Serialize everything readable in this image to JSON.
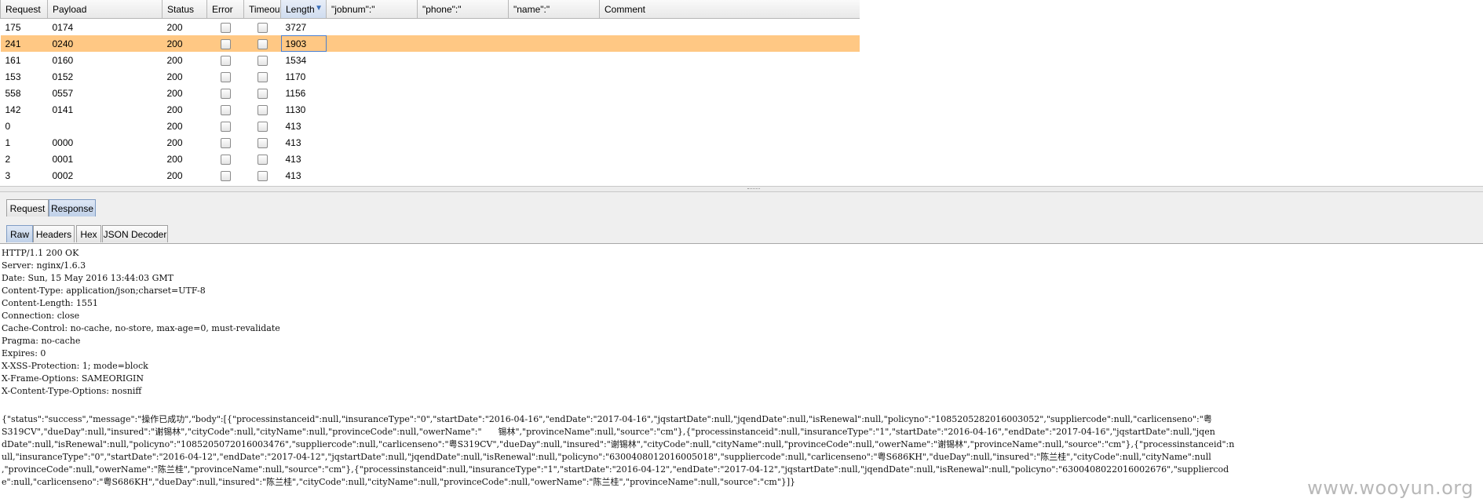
{
  "results": {
    "columns": [
      "Request",
      "Payload",
      "Status",
      "Error",
      "Timeout",
      "Length",
      "\"jobnum\":\"",
      "\"phone\":\"",
      "\"name\":\"",
      "Comment"
    ],
    "sorted_column": "Length",
    "sort_indicator": "▼",
    "rows": [
      {
        "request": "175",
        "payload": "0174",
        "status": "200",
        "length": "3727",
        "selected": false
      },
      {
        "request": "241",
        "payload": "0240",
        "status": "200",
        "length": "1903",
        "selected": true
      },
      {
        "request": "161",
        "payload": "0160",
        "status": "200",
        "length": "1534",
        "selected": false
      },
      {
        "request": "153",
        "payload": "0152",
        "status": "200",
        "length": "1170",
        "selected": false
      },
      {
        "request": "558",
        "payload": "0557",
        "status": "200",
        "length": "1156",
        "selected": false
      },
      {
        "request": "142",
        "payload": "0141",
        "status": "200",
        "length": "1130",
        "selected": false
      },
      {
        "request": "0",
        "payload": "",
        "status": "200",
        "length": "413",
        "selected": false
      },
      {
        "request": "1",
        "payload": "0000",
        "status": "200",
        "length": "413",
        "selected": false
      },
      {
        "request": "2",
        "payload": "0001",
        "status": "200",
        "length": "413",
        "selected": false
      },
      {
        "request": "3",
        "payload": "0002",
        "status": "200",
        "length": "413",
        "selected": false
      }
    ]
  },
  "tabs_top": [
    {
      "label": "Request",
      "active": false
    },
    {
      "label": "Response",
      "active": true
    }
  ],
  "tabs_sub": [
    {
      "label": "Raw",
      "active": true
    },
    {
      "label": "Headers",
      "active": false
    },
    {
      "label": "Hex",
      "active": false
    },
    {
      "label": "JSON Decoder",
      "active": false
    }
  ],
  "response": {
    "headers": [
      "HTTP/1.1 200 OK",
      "Server: nginx/1.6.3",
      "Date: Sun, 15 May 2016 13:44:03 GMT",
      "Content-Type: application/json;charset=UTF-8",
      "Content-Length: 1551",
      "Connection: close",
      "Cache-Control: no-cache, no-store, max-age=0, must-revalidate",
      "Pragma: no-cache",
      "Expires: 0",
      "X-XSS-Protection: 1; mode=block",
      "X-Frame-Options: SAMEORIGIN",
      "X-Content-Type-Options: nosniff"
    ],
    "body_lines": [
      "{\"status\":\"success\",\"message\":\"操作已成功\",\"body\":[{\"processinstanceid\":null,\"insuranceType\":\"0\",\"startDate\":\"2016-04-16\",\"endDate\":\"2017-04-16\",\"jqstartDate\":null,\"jqendDate\":null,\"isRenewal\":null,\"policyno\":\"1085205282016003052\",\"suppliercode\":null,\"carlicenseno\":\"粤",
      "S319CV\",\"dueDay\":null,\"insured\":\"谢锡林\",\"cityCode\":null,\"cityName\":null,\"provinceCode\":null,\"owerName\":\"      锡林\",\"provinceName\":null,\"source\":\"cm\"},{\"processinstanceid\":null,\"insuranceType\":\"1\",\"startDate\":\"2016-04-16\",\"endDate\":\"2017-04-16\",\"jqstartDate\":null,\"jqen",
      "dDate\":null,\"isRenewal\":null,\"policyno\":\"1085205072016003476\",\"suppliercode\":null,\"carlicenseno\":\"粤S319CV\",\"dueDay\":null,\"insured\":\"谢锡林\",\"cityCode\":null,\"cityName\":null,\"provinceCode\":null,\"owerName\":\"谢锡林\",\"provinceName\":null,\"source\":\"cm\"},{\"processinstanceid\":n",
      "ull,\"insuranceType\":\"0\",\"startDate\":\"2016-04-12\",\"endDate\":\"2017-04-12\",\"jqstartDate\":null,\"jqendDate\":null,\"isRenewal\":null,\"policyno\":\"6300408012016005018\",\"suppliercode\":null,\"carlicenseno\":\"粤S686KH\",\"dueDay\":null,\"insured\":\"陈兰桂\",\"cityCode\":null,\"cityName\":null",
      ",\"provinceCode\":null,\"owerName\":\"陈兰桂\",\"provinceName\":null,\"source\":\"cm\"},{\"processinstanceid\":null,\"insuranceType\":\"1\",\"startDate\":\"2016-04-12\",\"endDate\":\"2017-04-12\",\"jqstartDate\":null,\"jqendDate\":null,\"isRenewal\":null,\"policyno\":\"6300408022016002676\",\"suppliercod",
      "e\":null,\"carlicenseno\":\"粤S686KH\",\"dueDay\":null,\"insured\":\"陈兰桂\",\"cityCode\":null,\"cityName\":null,\"provinceCode\":null,\"owerName\":\"陈兰桂\",\"provinceName\":null,\"source\":\"cm\"}]}"
    ]
  },
  "watermark": "www.wooyun.org",
  "colors": {
    "selected_row": "#ffc884",
    "active_tab": "#bfd0e8",
    "header_bg": "#e8e8e8"
  }
}
